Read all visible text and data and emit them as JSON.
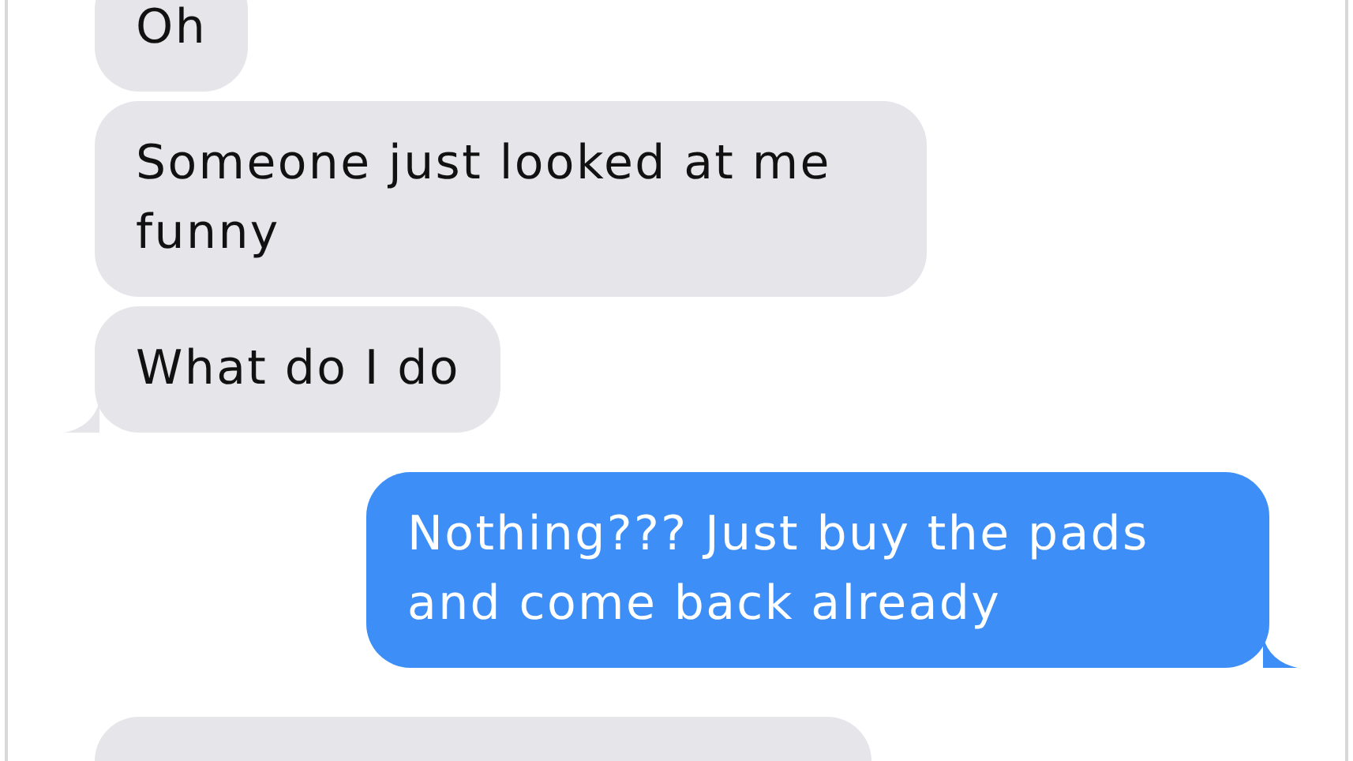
{
  "messages": [
    {
      "kind": "received",
      "text": "Oh",
      "tail": false
    },
    {
      "kind": "received",
      "text": "Someone just looked at me funny",
      "tail": false
    },
    {
      "kind": "received",
      "text": "What do I do",
      "tail": true
    },
    {
      "kind": "sent",
      "text": "Nothing??? Just buy the pads and come back already",
      "tail": true
    },
    {
      "kind": "received",
      "tail": false
    }
  ]
}
